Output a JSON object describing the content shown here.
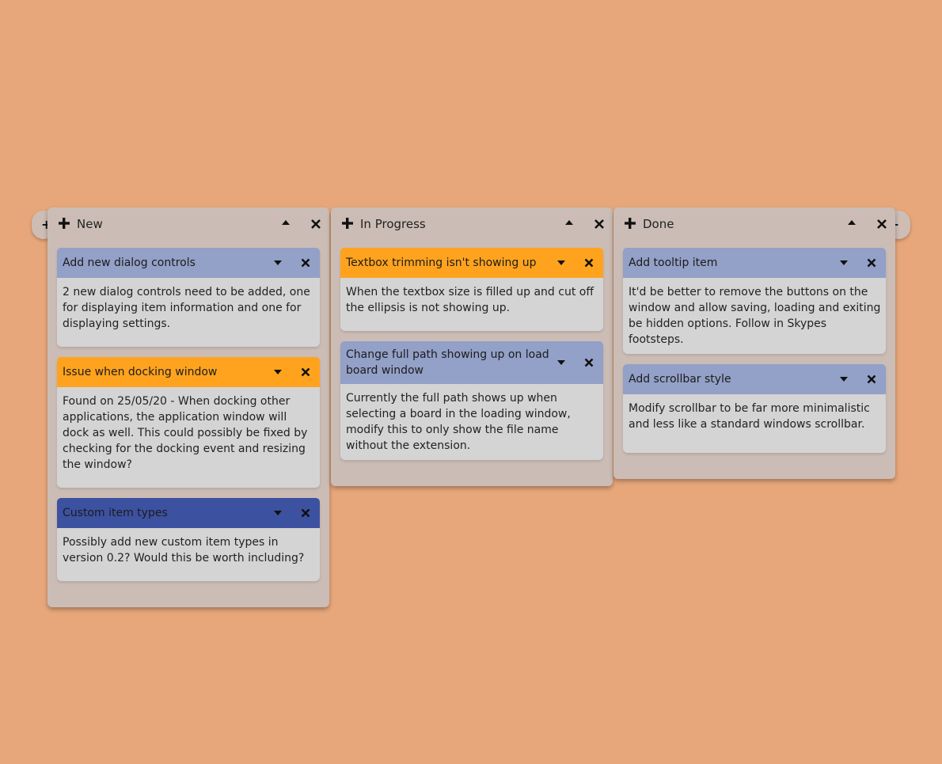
{
  "boards": [
    {
      "title": "New",
      "cards": [
        {
          "title": "Add new dialog controls",
          "color": "#93a0c7",
          "body": "2 new dialog controls need to be added, one for displaying item information and one for displaying settings."
        },
        {
          "title": "Issue when docking window",
          "color": "#ffa31e",
          "body": "Found on 25/05/20 - When docking other applications, the application window will dock as well. This could possibly be fixed by checking for the docking event and resizing the window?"
        },
        {
          "title": "Custom item types",
          "color": "#3c51a0",
          "body": "Possibly add new custom item types in version 0.2? Would this be worth including?"
        }
      ]
    },
    {
      "title": "In Progress",
      "cards": [
        {
          "title": "Textbox trimming isn't showing up",
          "color": "#ffa31e",
          "body": "When the textbox size is filled up and cut off the ellipsis is not showing up."
        },
        {
          "title": "Change full path showing up on load board window",
          "color": "#93a0c7",
          "body": "Currently the full path shows up when selecting a board in the loading window, modify this to only show the file name without the extension."
        }
      ]
    },
    {
      "title": "Done",
      "cards": [
        {
          "title": "Add tooltip item",
          "color": "#93a0c7",
          "body": "It'd be better to remove the buttons on the window and allow saving, loading and exiting be hidden options. Follow in Skypes footsteps."
        },
        {
          "title": "Add scrollbar style",
          "color": "#93a0c7",
          "body": "Modify scrollbar to be far more minimalistic and less like a standard windows scrollbar."
        }
      ]
    }
  ],
  "icons": {
    "add": "plus-icon",
    "collapse": "caret-up-icon",
    "expand": "caret-down-icon",
    "close": "close-icon"
  },
  "colors": {
    "background": "#e8a77b",
    "board": "#cbbdb5",
    "card_body": "#d4d4d4",
    "accent_orange": "#ffa31e",
    "accent_grey_blue": "#93a0c7",
    "accent_blue": "#3c51a0"
  }
}
